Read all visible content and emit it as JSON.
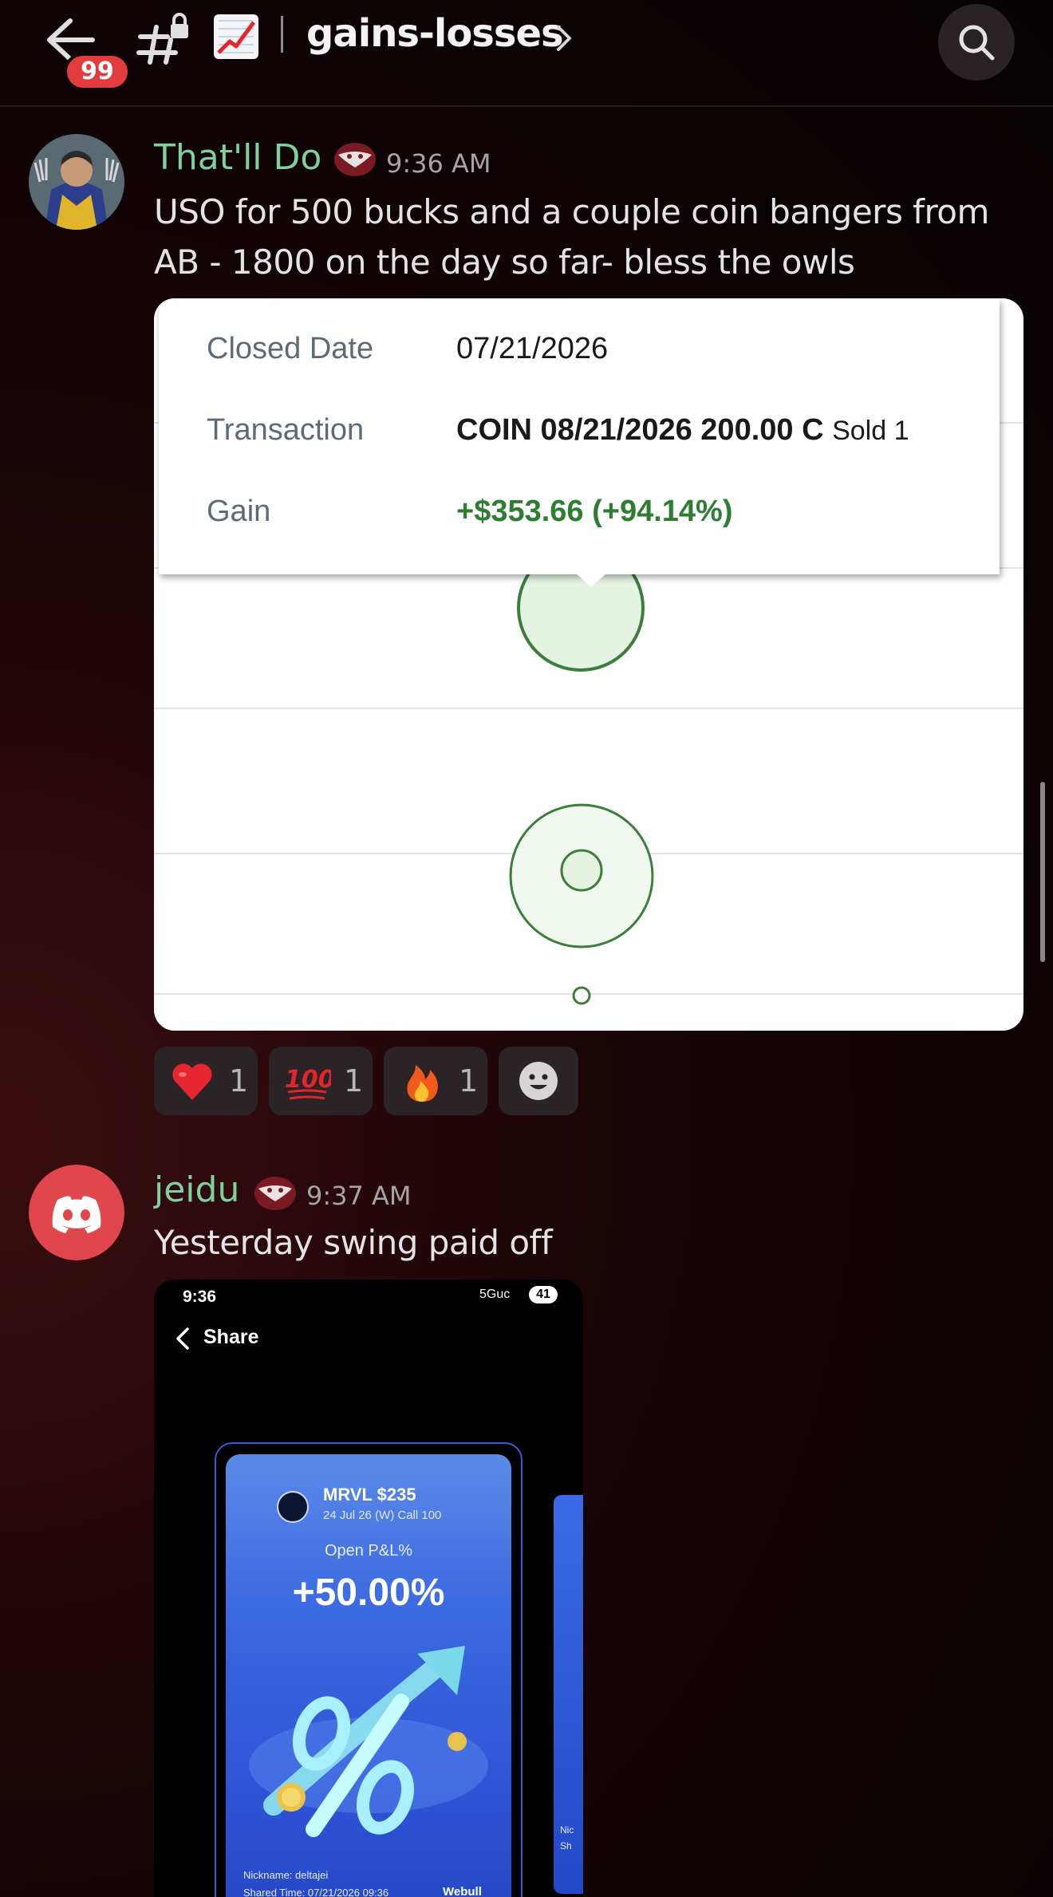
{
  "header": {
    "unread_badge": "99",
    "channel_name": "gains-losses",
    "icons": [
      "back-arrow-icon",
      "locked-hash-icon",
      "chart-increasing-emoji-icon",
      "chevron-right-icon",
      "search-icon"
    ]
  },
  "messages": [
    {
      "username": "That'll Do",
      "time": "9:36 AM",
      "text_line1": "USO for 500 bucks and a couple coin bangers from",
      "text_line2": "AB - 1800 on the day so far- bless the owls",
      "attachment": {
        "tooltip": {
          "closed_date_label": "Closed Date",
          "closed_date_value": "07/21/2026",
          "transaction_label": "Transaction",
          "transaction_value": "COIN 08/21/2026 200.00 C",
          "transaction_suffix": "Sold 1",
          "gain_label": "Gain",
          "gain_value": "+$353.66 (+94.14%)"
        }
      },
      "reactions": [
        {
          "emoji": "heart-emoji-icon",
          "count": "1"
        },
        {
          "emoji": "hundred-emoji-icon",
          "count": "1"
        },
        {
          "emoji": "fire-emoji-icon",
          "count": "1"
        }
      ]
    },
    {
      "username": "jeidu",
      "time": "9:37 AM",
      "text_line1": "Yesterday swing paid off",
      "attachment": {
        "status_time": "9:36",
        "status_network": "5Guc",
        "status_battery": "41",
        "share_label": "Share",
        "card": {
          "ticker": "MRVL $235",
          "contract": "24 Jul 26 (W) Call 100",
          "pl_label": "Open P&L%",
          "pl_value": "+50.00%",
          "nickname": "Nickname: deltajei",
          "shared_time": "Shared Time: 07/21/2026 09:36",
          "brand": "Webull"
        },
        "next_card_text_1": "Nic",
        "next_card_text_2": "Sh"
      }
    }
  ],
  "colors": {
    "username": "#7fd09a",
    "gain_green": "#2f7d33",
    "badge_red": "#e23c3f"
  }
}
